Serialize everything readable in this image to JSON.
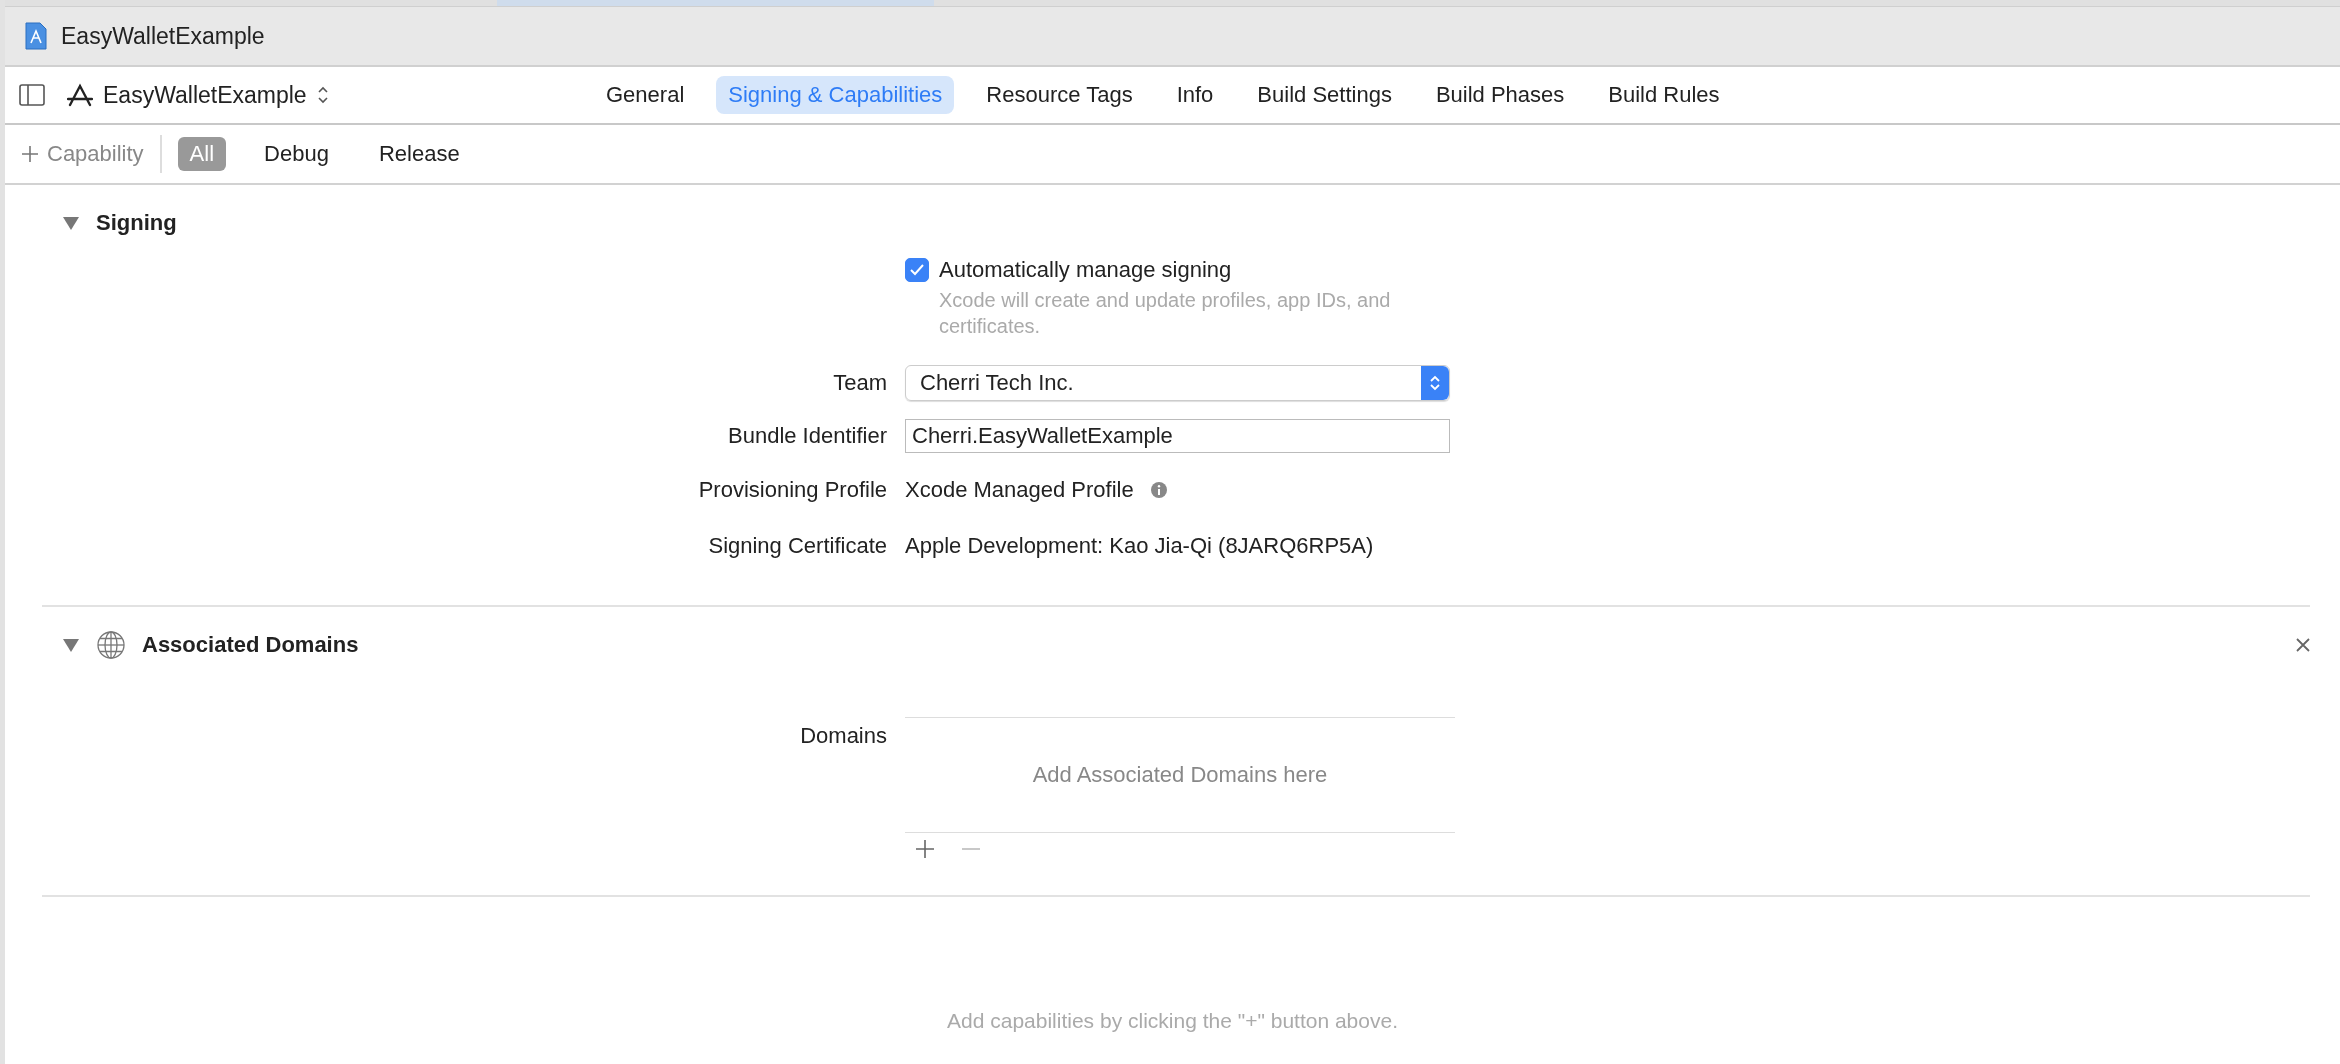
{
  "window": {
    "title": "EasyWalletExample"
  },
  "toolbar": {
    "target": "EasyWalletExample"
  },
  "tabs": [
    {
      "label": "General",
      "selected": false
    },
    {
      "label": "Signing & Capabilities",
      "selected": true
    },
    {
      "label": "Resource Tags",
      "selected": false
    },
    {
      "label": "Info",
      "selected": false
    },
    {
      "label": "Build Settings",
      "selected": false
    },
    {
      "label": "Build Phases",
      "selected": false
    },
    {
      "label": "Build Rules",
      "selected": false
    }
  ],
  "filter_bar": {
    "add_label": "Capability",
    "configurations": [
      {
        "label": "All",
        "selected": true
      },
      {
        "label": "Debug",
        "selected": false
      },
      {
        "label": "Release",
        "selected": false
      }
    ]
  },
  "signing": {
    "title": "Signing",
    "expanded": true,
    "auto_manage": {
      "label": "Automatically manage signing",
      "checked": true,
      "note": "Xcode will create and update profiles, app IDs, and certificates."
    },
    "fields": [
      {
        "kind": "popup",
        "label": "Team",
        "value": "Cherri Tech Inc."
      },
      {
        "kind": "text_field",
        "label": "Bundle Identifier",
        "value": "Cherri.EasyWalletExample"
      },
      {
        "kind": "info",
        "label": "Provisioning Profile",
        "value": "Xcode Managed Profile"
      },
      {
        "kind": "text",
        "label": "Signing Certificate",
        "value": "Apple Development: Kao Jia-Qi (8JARQ6RP5A)"
      }
    ]
  },
  "associated_domains": {
    "title": "Associated Domains",
    "expanded": true,
    "label": "Domains",
    "placeholder": "Add Associated Domains here"
  },
  "footer_hint": "Add capabilities by clicking the \"+\" button above."
}
